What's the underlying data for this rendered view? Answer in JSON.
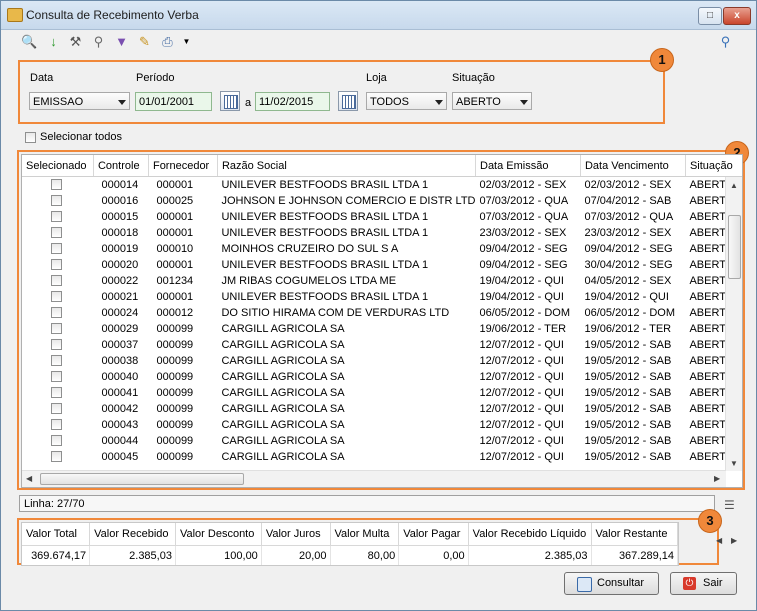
{
  "window": {
    "title": "Consulta de Recebimento Verba"
  },
  "filters": {
    "data_label": "Data",
    "data_value": "EMISSAO",
    "periodo_label": "Período",
    "date_from": "01/01/2001",
    "separator": "a",
    "date_to": "11/02/2015",
    "loja_label": "Loja",
    "loja_value": "TODOS",
    "situacao_label": "Situação",
    "situacao_value": "ABERTO"
  },
  "select_all_label": "Selecionar todos",
  "callouts": [
    "1",
    "2",
    "3"
  ],
  "grid": {
    "columns": [
      "Selecionado",
      "Controle",
      "Fornecedor",
      "Razão Social",
      "Data Emissão",
      "Data Vencimento",
      "Situação"
    ],
    "rows": [
      [
        "000014",
        "000001",
        "UNILEVER BESTFOODS BRASIL LTDA 1",
        "02/03/2012 - SEX",
        "02/03/2012 - SEX",
        "ABERTO"
      ],
      [
        "000016",
        "000025",
        "JOHNSON E JOHNSON COMERCIO E DISTR LTD",
        "07/03/2012 - QUA",
        "07/04/2012 - SAB",
        "ABERTO"
      ],
      [
        "000015",
        "000001",
        "UNILEVER BESTFOODS BRASIL LTDA 1",
        "07/03/2012 - QUA",
        "07/03/2012 - QUA",
        "ABERTO"
      ],
      [
        "000018",
        "000001",
        "UNILEVER BESTFOODS BRASIL LTDA 1",
        "23/03/2012 - SEX",
        "23/03/2012 - SEX",
        "ABERTO"
      ],
      [
        "000019",
        "000010",
        "MOINHOS CRUZEIRO DO SUL S A",
        "09/04/2012 - SEG",
        "09/04/2012 - SEG",
        "ABERTO"
      ],
      [
        "000020",
        "000001",
        "UNILEVER BESTFOODS BRASIL LTDA 1",
        "09/04/2012 - SEG",
        "30/04/2012 - SEG",
        "ABERTO"
      ],
      [
        "000022",
        "001234",
        "JM RIBAS COGUMELOS LTDA ME",
        "19/04/2012 - QUI",
        "04/05/2012 - SEX",
        "ABERTO"
      ],
      [
        "000021",
        "000001",
        "UNILEVER BESTFOODS BRASIL LTDA 1",
        "19/04/2012 - QUI",
        "19/04/2012 - QUI",
        "ABERTO"
      ],
      [
        "000024",
        "000012",
        "DO SITIO HIRAMA COM DE VERDURAS LTD",
        "06/05/2012 - DOM",
        "06/05/2012 - DOM",
        "ABERTO"
      ],
      [
        "000029",
        "000099",
        "CARGILL AGRICOLA SA",
        "19/06/2012 - TER",
        "19/06/2012 - TER",
        "ABERTO"
      ],
      [
        "000037",
        "000099",
        "CARGILL AGRICOLA SA",
        "12/07/2012 - QUI",
        "19/05/2012 - SAB",
        "ABERTO"
      ],
      [
        "000038",
        "000099",
        "CARGILL AGRICOLA SA",
        "12/07/2012 - QUI",
        "19/05/2012 - SAB",
        "ABERTO"
      ],
      [
        "000040",
        "000099",
        "CARGILL AGRICOLA SA",
        "12/07/2012 - QUI",
        "19/05/2012 - SAB",
        "ABERTO"
      ],
      [
        "000041",
        "000099",
        "CARGILL AGRICOLA SA",
        "12/07/2012 - QUI",
        "19/05/2012 - SAB",
        "ABERTO"
      ],
      [
        "000042",
        "000099",
        "CARGILL AGRICOLA SA",
        "12/07/2012 - QUI",
        "19/05/2012 - SAB",
        "ABERTO"
      ],
      [
        "000043",
        "000099",
        "CARGILL AGRICOLA SA",
        "12/07/2012 - QUI",
        "19/05/2012 - SAB",
        "ABERTO"
      ],
      [
        "000044",
        "000099",
        "CARGILL AGRICOLA SA",
        "12/07/2012 - QUI",
        "19/05/2012 - SAB",
        "ABERTO"
      ],
      [
        "000045",
        "000099",
        "CARGILL AGRICOLA SA",
        "12/07/2012 - QUI",
        "19/05/2012 - SAB",
        "ABERTO"
      ]
    ]
  },
  "status": {
    "linha": "Linha: 27/70"
  },
  "totals": {
    "headers": [
      "Valor Total",
      "Valor Recebido",
      "Valor Desconto",
      "Valor Juros",
      "Valor Multa",
      "Valor Pagar",
      "Valor Recebido Líquido",
      "Valor Restante"
    ],
    "values": [
      "369.674,17",
      "2.385,03",
      "100,00",
      "20,00",
      "80,00",
      "0,00",
      "2.385,03",
      "367.289,14"
    ]
  },
  "buttons": {
    "consultar": "Consultar",
    "sair": "Sair"
  },
  "icons": [
    "search-doc-icon",
    "download-arrow-icon",
    "tools-icon",
    "key-search-icon",
    "filter-icon",
    "edit-icon",
    "print-icon",
    "magnifier-icon"
  ],
  "colors": {
    "accent": "#f0883a",
    "date_field_bg": "#eaf7ea"
  }
}
